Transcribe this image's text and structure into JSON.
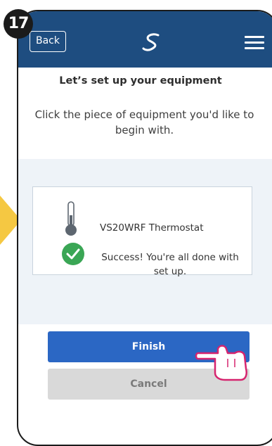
{
  "step_number": "17",
  "header": {
    "back_label": "Back",
    "logo_icon": "brand-s-logo-icon",
    "menu_icon": "hamburger-menu-icon"
  },
  "page": {
    "title": "Let’s set up your equipment",
    "instruction": "Click the piece of equipment you'd like to begin with."
  },
  "equipment": [
    {
      "name": "VS20WRF Thermostat",
      "icon": "thermometer-icon",
      "status": "Success! You're all done with set up.",
      "status_icon": "check-circle-icon"
    }
  ],
  "buttons": {
    "finish_label": "Finish",
    "cancel_label": "Cancel"
  },
  "colors": {
    "header": "#1e4d80",
    "primary_button": "#2b67c4",
    "success": "#3aa655",
    "pointer_hand": "#d6246e",
    "side_arrow": "#f5c842"
  }
}
